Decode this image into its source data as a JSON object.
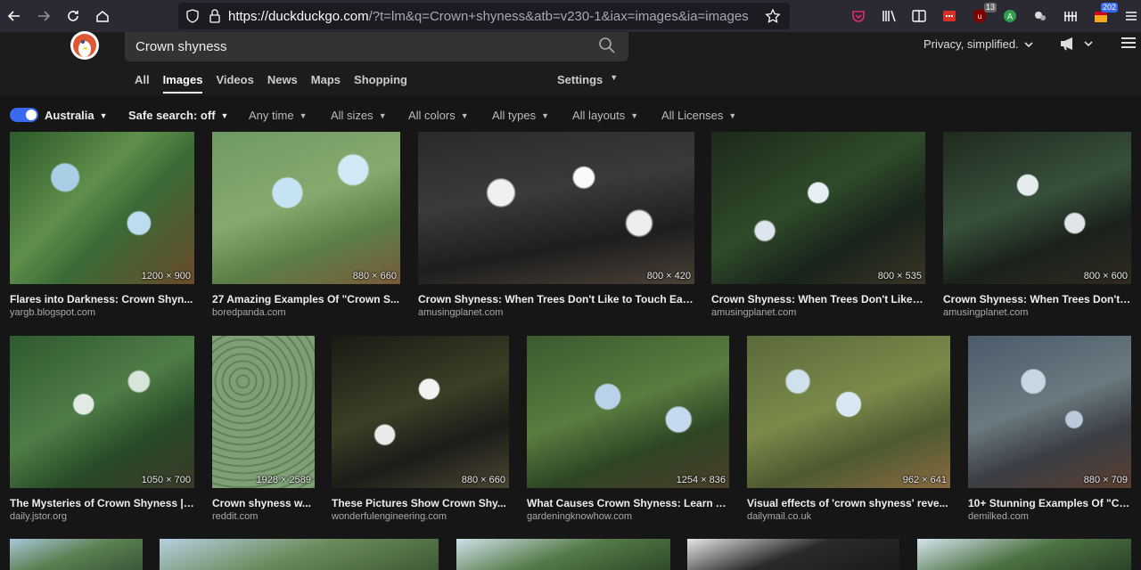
{
  "browser": {
    "url_host": "https://duckduckgo.com",
    "url_rest": "/?t=lm&q=Crown+shyness&atb=v230-1&iax=images&ia=images",
    "badge_ublock": "13",
    "badge_calendar": "202"
  },
  "search": {
    "query": "Crown shyness"
  },
  "header": {
    "privacy_label": "Privacy, simplified."
  },
  "tabs": [
    {
      "label": "All"
    },
    {
      "label": "Images"
    },
    {
      "label": "Videos"
    },
    {
      "label": "News"
    },
    {
      "label": "Maps"
    },
    {
      "label": "Shopping"
    }
  ],
  "settings_label": "Settings",
  "filters": {
    "region": "Australia",
    "safe_search": "Safe search: off",
    "time": "Any time",
    "size": "All sizes",
    "color": "All colors",
    "type": "All types",
    "layout": "All layouts",
    "license": "All Licenses"
  },
  "results": [
    {
      "title": "Flares into Darkness: Crown Shyn...",
      "source": "yargb.blogspot.com",
      "dims": "1200 × 900"
    },
    {
      "title": "27 Amazing Examples Of \"Crown S...",
      "source": "boredpanda.com",
      "dims": "880 × 660"
    },
    {
      "title": "Crown Shyness: When Trees Don't Like to Touch Eac...",
      "source": "amusingplanet.com",
      "dims": "800 × 420"
    },
    {
      "title": "Crown Shyness: When Trees Don't Like t...",
      "source": "amusingplanet.com",
      "dims": "800 × 535"
    },
    {
      "title": "Crown Shyness: When Trees Don't ...",
      "source": "amusingplanet.com",
      "dims": "800 × 600"
    },
    {
      "title": "The Mysteries of Crown Shyness | ...",
      "source": "daily.jstor.org",
      "dims": "1050 × 700"
    },
    {
      "title": "Crown shyness w...",
      "source": "reddit.com",
      "dims": "1928 × 2589"
    },
    {
      "title": "These Pictures Show Crown Shy...",
      "source": "wonderfulengineering.com",
      "dims": "880 × 660"
    },
    {
      "title": "What Causes Crown Shyness: Learn A...",
      "source": "gardeningknowhow.com",
      "dims": "1254 × 836"
    },
    {
      "title": "Visual effects of 'crown shyness' reve...",
      "source": "dailymail.co.uk",
      "dims": "962 × 641"
    },
    {
      "title": "10+ Stunning Examples Of \"Cr...",
      "source": "demilked.com",
      "dims": "880 × 709"
    }
  ]
}
